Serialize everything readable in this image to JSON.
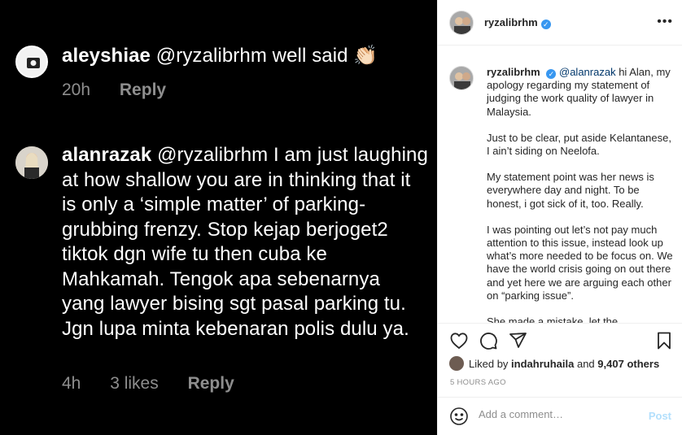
{
  "media": {
    "comments": [
      {
        "username": "aleyshiae",
        "text": "@ryzalibrhm well said 👏🏻",
        "time": "20h",
        "likes": "",
        "reply": "Reply"
      },
      {
        "username": "alanrazak",
        "text": "@ryzalibrhm I am just laughing at how shallow you are in thinking that it is only a ‘simple matter’ of parking-grubbing frenzy. Stop kejap berjoget2 tiktok dgn wife tu then cuba ke Mahkamah. Tengok apa sebenarnya yang lawyer bising sgt pasal parking tu. Jgn lupa minta kebenaran polis dulu ya.",
        "time": "4h",
        "likes": "3 likes",
        "reply": "Reply"
      }
    ]
  },
  "post": {
    "username": "ryzalibrhm",
    "verified": true,
    "more_label": "•••",
    "caption": {
      "username": "ryzalibrhm",
      "mention": "@alanrazak",
      "paragraphs": [
        "hi Alan, my apology regarding my statement of judging the work quality of lawyer in Malaysia.",
        "Just to be clear, put aside Kelantanese, I ain’t siding on Neelofa.",
        "My statement point was her news is everywhere day and night. To be honest, i got sick of it, too. Really.",
        "I was pointing out let’s not pay much attention to this issue, instead look up what’s more needed to be focus on. We have the world crisis going on out there and yet here we are arguing each other on “parking issue”.",
        "She made a mistake, let the"
      ]
    },
    "likes": {
      "prefix": "Liked by",
      "user": "indahruhaila",
      "joiner": "and",
      "count": "9,407 others"
    },
    "timestamp": "5 HOURS AGO",
    "add_comment": {
      "placeholder": "Add a comment…",
      "post_label": "Post"
    },
    "colors": {
      "verified": "#3897f0",
      "post_button": "#b2dffc",
      "mention": "#00376b"
    }
  }
}
